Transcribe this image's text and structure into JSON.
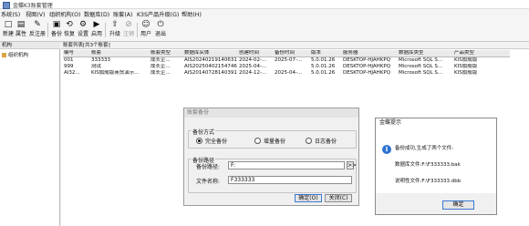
{
  "window": {
    "title": "金蝶K3账套管理"
  },
  "menu": [
    "系统(S)",
    "视图(V)",
    "组织机构(O)",
    "数据库(D)",
    "账套(A)",
    "K3S产品升级(G)",
    "帮助(H)"
  ],
  "toolbar": [
    {
      "label": "新建",
      "icon": "new-icon",
      "glyph": "□",
      "enabled": true
    },
    {
      "label": "属性",
      "icon": "properties-icon",
      "glyph": "▤",
      "enabled": true
    },
    {
      "label": "反注册",
      "icon": "unregister-icon",
      "glyph": "✎",
      "enabled": true
    },
    {
      "label": "备份",
      "icon": "backup-icon",
      "glyph": "▣",
      "enabled": true
    },
    {
      "label": "恢复",
      "icon": "restore-icon",
      "glyph": "⟲",
      "enabled": true
    },
    {
      "label": "设置",
      "icon": "settings-icon",
      "glyph": "⚙",
      "enabled": true
    },
    {
      "label": "启用",
      "icon": "enable-icon",
      "glyph": "▶",
      "enabled": true
    },
    {
      "label": "升级",
      "icon": "upgrade-icon",
      "glyph": "⇧",
      "enabled": true
    },
    {
      "label": "注销",
      "icon": "logout-icon",
      "glyph": "⊘",
      "enabled": false
    },
    {
      "label": "用户",
      "icon": "user-icon",
      "glyph": "☺",
      "enabled": true
    },
    {
      "label": "退出",
      "icon": "exit-icon",
      "glyph": "⏻",
      "enabled": true
    }
  ],
  "left_panel": {
    "header": "机构",
    "node": "组织机构"
  },
  "list": {
    "header": "账套列表[共3个账套]",
    "columns": [
      "编号",
      "账套",
      "账套类型",
      "数据库实体",
      "创建时间",
      "备份时间",
      "版本",
      "服务器",
      "数据库类型",
      "产品类型"
    ],
    "rows": [
      [
        "001",
        "333333",
        "成长企...",
        "AIS20240219140631",
        "2024-02-...",
        "2025-07-...",
        "5.0.01.26",
        "DESKTOP-HJAHKPQ",
        "Microsoft SQL S...",
        "KIS旗舰版"
      ],
      [
        "999",
        "测试",
        "成长企...",
        "AIS20250402154746",
        "2025-04-...",
        "",
        "5.0.01.26",
        "DESKTOP-HJAHKPQ",
        "Microsoft SQL S...",
        "KIS旗舰版"
      ],
      [
        "AI32...",
        "KIS旗舰版商贸演示...",
        "成长企...",
        "AIS20140728140391",
        "2024-12-...",
        "2025-04-...",
        "5.0.01.26",
        "DESKTOP-HJAHKPQ",
        "Microsoft SQL S...",
        "KIS旗舰版"
      ]
    ]
  },
  "backup_dialog": {
    "title": "账套备份",
    "method_label": "备份方式",
    "options": [
      "完全备份",
      "增量备份",
      "日志备份"
    ],
    "selected": "完全备份",
    "path_group": "备份路径",
    "path_label": "备份路径:",
    "path_value": "F:",
    "browse": ">>",
    "file_label": "文件名称:",
    "file_value": "F333333",
    "ok": "确定(O)",
    "close": "关闭(C)"
  },
  "message_box": {
    "title": "金蝶提示",
    "line1": "备份成功,生成了两个文件:",
    "line2": "数据库文件:F:\\F333333.bak",
    "line3": "说明性文件:F:\\F333333.dbb",
    "ok": "确定"
  }
}
